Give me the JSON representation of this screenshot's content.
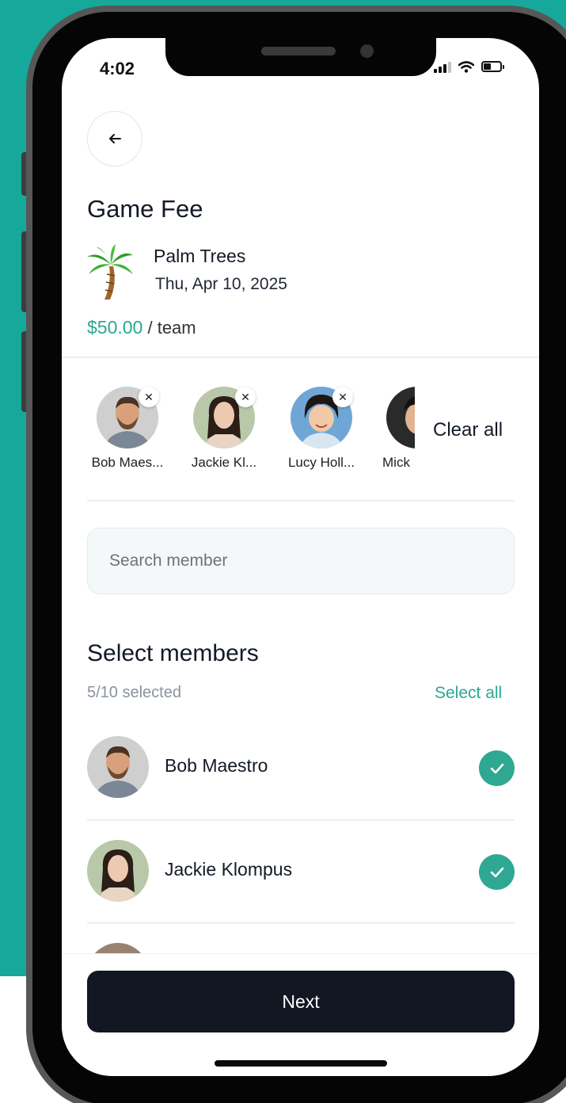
{
  "status_bar": {
    "time": "4:02"
  },
  "header": {
    "title": "Game Fee"
  },
  "event": {
    "venue": "Palm Trees",
    "date": "Thu, Apr 10, 2025",
    "price": "$50.00",
    "price_unit": "/ team",
    "venue_icon": "palm-tree-icon"
  },
  "selected_chips": [
    {
      "label": "Bob Maes..."
    },
    {
      "label": "Jackie Kl..."
    },
    {
      "label": "Lucy Holl..."
    },
    {
      "label": "Mick"
    }
  ],
  "clear_all_label": "Clear all",
  "search": {
    "placeholder": "Search member"
  },
  "members_section": {
    "title": "Select members",
    "count": "5/10 selected",
    "select_all_label": "Select all"
  },
  "members": [
    {
      "name": "Bob Maestro",
      "selected": true
    },
    {
      "name": "Jackie Klompus",
      "selected": true
    }
  ],
  "next_label": "Next",
  "colors": {
    "accent": "#2aa791",
    "background": "#17a89c",
    "button": "#121722"
  }
}
